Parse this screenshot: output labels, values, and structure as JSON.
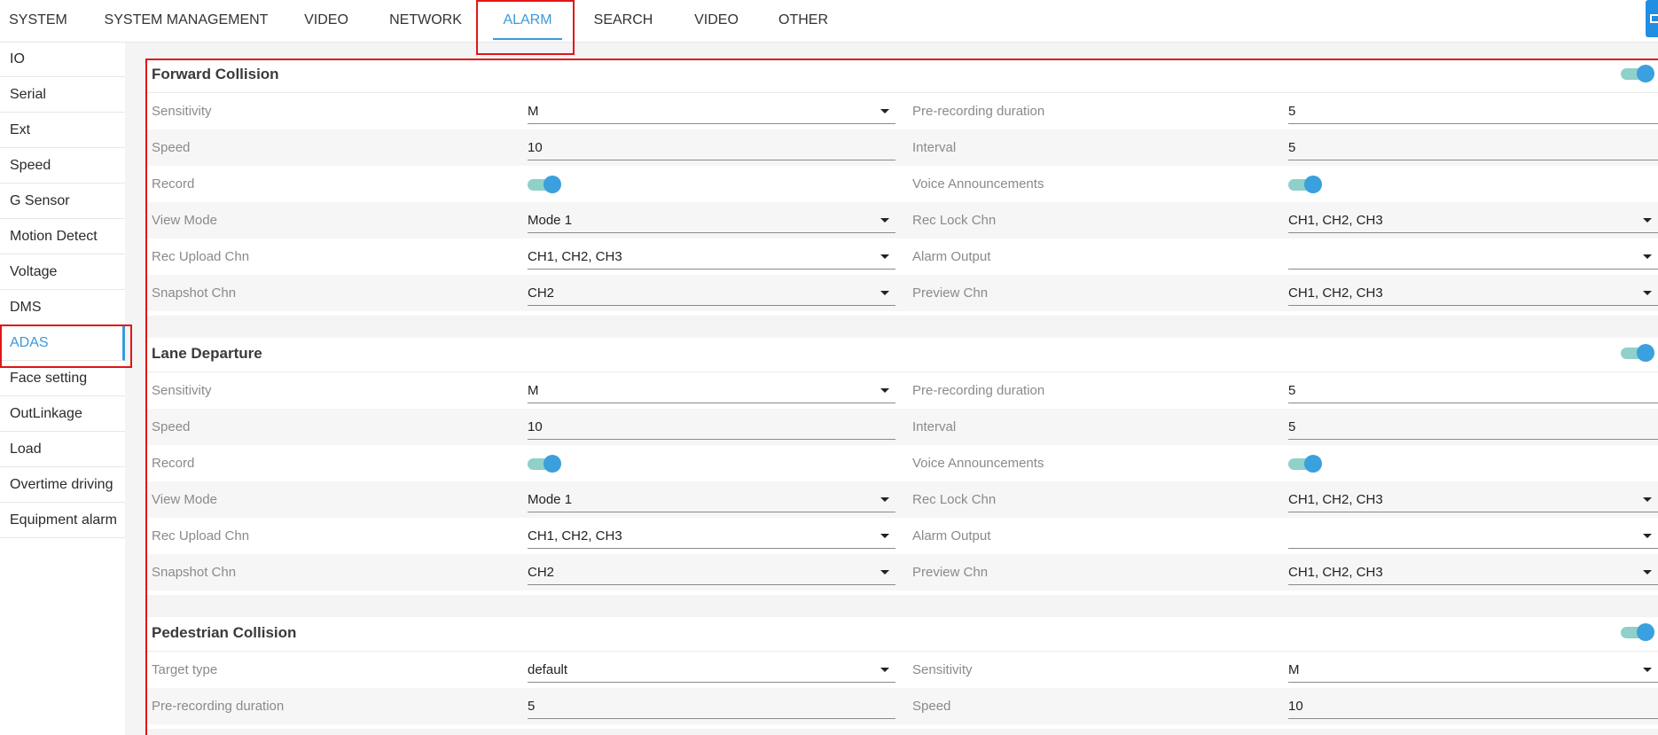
{
  "nav": {
    "tabs": [
      {
        "label": "SYSTEM"
      },
      {
        "label": "SYSTEM MANAGEMENT"
      },
      {
        "label": "VIDEO"
      },
      {
        "label": "NETWORK"
      },
      {
        "label": "ALARM",
        "active": true
      },
      {
        "label": "SEARCH"
      },
      {
        "label": "VIDEO"
      },
      {
        "label": "OTHER"
      }
    ],
    "accent_color": "#3b9ad9",
    "highlight_color": "#e21515"
  },
  "sidebar": {
    "items": [
      {
        "label": "IO"
      },
      {
        "label": "Serial"
      },
      {
        "label": "Ext"
      },
      {
        "label": "Speed"
      },
      {
        "label": "G Sensor"
      },
      {
        "label": "Motion Detect"
      },
      {
        "label": "Voltage"
      },
      {
        "label": "DMS"
      },
      {
        "label": "ADAS",
        "active": true
      },
      {
        "label": "Face setting"
      },
      {
        "label": "OutLinkage"
      },
      {
        "label": "Load"
      },
      {
        "label": "Overtime driving"
      },
      {
        "label": "Equipment alarm"
      }
    ]
  },
  "sections": [
    {
      "title": "Forward Collision",
      "enabled": true,
      "rows": [
        {
          "left_label": "Sensitivity",
          "left_value": "M",
          "left_kind": "select",
          "right_label": "Pre-recording duration",
          "right_value": "5",
          "right_kind": "input"
        },
        {
          "left_label": "Speed",
          "left_value": "10",
          "left_kind": "input",
          "right_label": "Interval",
          "right_value": "5",
          "right_kind": "input"
        },
        {
          "left_label": "Record",
          "left_value": "on",
          "left_kind": "switch",
          "right_label": "Voice Announcements",
          "right_value": "on",
          "right_kind": "switch"
        },
        {
          "left_label": "View Mode",
          "left_value": "Mode 1",
          "left_kind": "select",
          "right_label": "Rec Lock Chn",
          "right_value": "CH1, CH2, CH3",
          "right_kind": "select"
        },
        {
          "left_label": "Rec Upload Chn",
          "left_value": "CH1, CH2, CH3",
          "left_kind": "select",
          "right_label": "Alarm Output",
          "right_value": "",
          "right_kind": "select"
        },
        {
          "left_label": "Snapshot Chn",
          "left_value": "CH2",
          "left_kind": "select",
          "right_label": "Preview Chn",
          "right_value": "CH1, CH2, CH3",
          "right_kind": "select"
        }
      ]
    },
    {
      "title": "Lane Departure",
      "enabled": true,
      "rows": [
        {
          "left_label": "Sensitivity",
          "left_value": "M",
          "left_kind": "select",
          "right_label": "Pre-recording duration",
          "right_value": "5",
          "right_kind": "input"
        },
        {
          "left_label": "Speed",
          "left_value": "10",
          "left_kind": "input",
          "right_label": "Interval",
          "right_value": "5",
          "right_kind": "input"
        },
        {
          "left_label": "Record",
          "left_value": "on",
          "left_kind": "switch",
          "right_label": "Voice Announcements",
          "right_value": "on",
          "right_kind": "switch"
        },
        {
          "left_label": "View Mode",
          "left_value": "Mode 1",
          "left_kind": "select",
          "right_label": "Rec Lock Chn",
          "right_value": "CH1, CH2, CH3",
          "right_kind": "select"
        },
        {
          "left_label": "Rec Upload Chn",
          "left_value": "CH1, CH2, CH3",
          "left_kind": "select",
          "right_label": "Alarm Output",
          "right_value": "",
          "right_kind": "select"
        },
        {
          "left_label": "Snapshot Chn",
          "left_value": "CH2",
          "left_kind": "select",
          "right_label": "Preview Chn",
          "right_value": "CH1, CH2, CH3",
          "right_kind": "select"
        }
      ]
    },
    {
      "title": "Pedestrian Collision",
      "enabled": true,
      "rows": [
        {
          "left_label": "Target type",
          "left_value": "default",
          "left_kind": "select",
          "right_label": "Sensitivity",
          "right_value": "M",
          "right_kind": "select"
        },
        {
          "left_label": "Pre-recording duration",
          "left_value": "5",
          "left_kind": "input",
          "right_label": "Speed",
          "right_value": "10",
          "right_kind": "input"
        }
      ]
    }
  ]
}
